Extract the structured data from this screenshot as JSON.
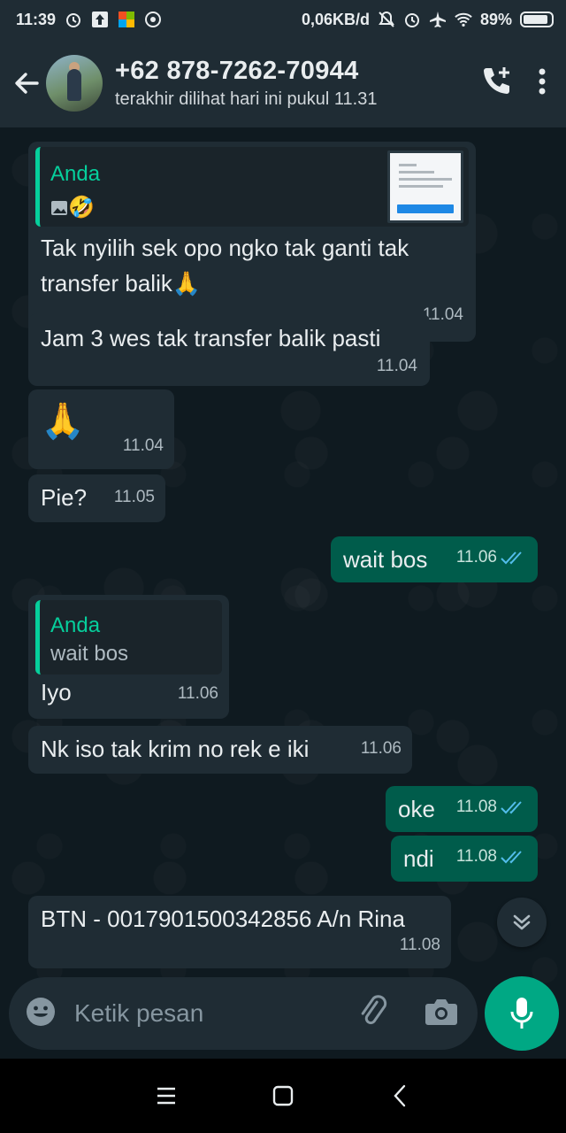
{
  "status_bar": {
    "time": "11:39",
    "network_speed": "0,06KB/d",
    "battery": "89%",
    "battery_level": 0.89
  },
  "header": {
    "contact_name": "+62 878-7262-70944",
    "last_seen": "terakhir dilihat hari ini pukul 11.31"
  },
  "messages": [
    {
      "direction": "in",
      "quote": {
        "author": "Anda",
        "emoji": "🤣"
      },
      "text": "Tak nyilih sek opo ngko tak ganti tak transfer balik🙏",
      "time": "11.04"
    },
    {
      "direction": "in",
      "text": "Jam 3 wes tak transfer balik pasti",
      "time": "11.04"
    },
    {
      "direction": "in",
      "text": "🙏",
      "time": "11.04"
    },
    {
      "direction": "in",
      "text": "Pie?",
      "time": "11.05"
    },
    {
      "direction": "out",
      "text": "wait bos",
      "time": "11.06"
    },
    {
      "direction": "in",
      "quote": {
        "author": "Anda",
        "text": "wait bos"
      },
      "text": "Iyo",
      "time": "11.06"
    },
    {
      "direction": "in",
      "text": "Nk iso tak krim no rek e iki",
      "time": "11.06"
    },
    {
      "direction": "out",
      "text": "oke",
      "time": "11.08"
    },
    {
      "direction": "out",
      "text": "ndi",
      "time": "11.08"
    },
    {
      "direction": "in",
      "text": "BTN - 0017901500342856 A/n Rina",
      "time": "11.08"
    }
  ],
  "composer": {
    "placeholder": "Ketik pesan"
  },
  "colors": {
    "accent": "#00a884",
    "incoming_bubble": "#1f2c34",
    "outgoing_bubble": "#005c4b",
    "read_ticks": "#53bdeb"
  }
}
